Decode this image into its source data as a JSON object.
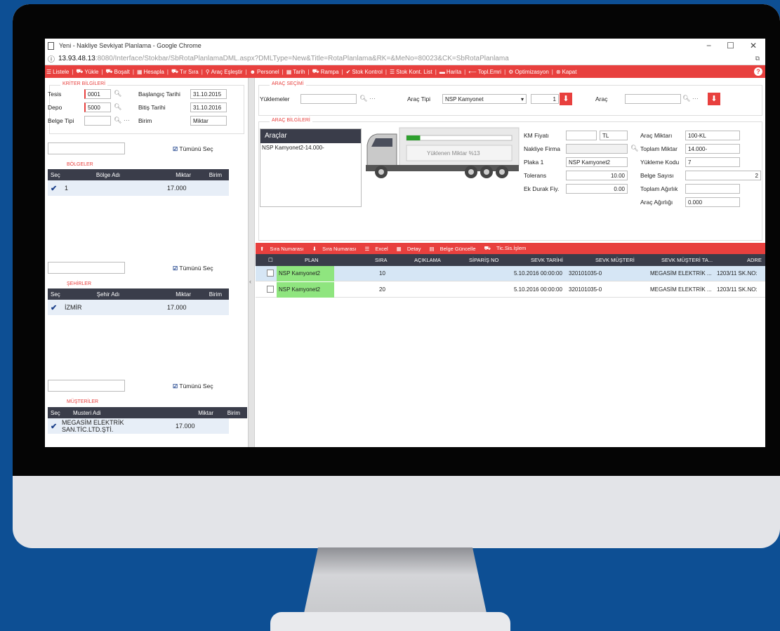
{
  "browser": {
    "title": "Yeni - Nakliye Sevkiyat Planlama - Google Chrome",
    "info_icon": "ⓘ",
    "url_host": "13.93.48.13",
    "url_path": ":8080/Interface/Stokbar/SbRotaPlanlamaDML.aspx?DMLType=New&Title=RotaPlanlama&RK=&MeNo=80023&CK=SbRotaPlanlama",
    "minimize": "−",
    "maximize": "☐",
    "close": "✕"
  },
  "menu": [
    {
      "icon": "list-icon",
      "label": "Listele"
    },
    {
      "icon": "truck-icon",
      "label": "Yükle"
    },
    {
      "icon": "truck-icon",
      "label": "Boşalt"
    },
    {
      "icon": "calculator-icon",
      "label": "Hesapla"
    },
    {
      "icon": "truck-order-icon",
      "label": "Tır Sıra"
    },
    {
      "icon": "match-icon",
      "label": "Araç Eşleştir"
    },
    {
      "icon": "person-icon",
      "label": "Personel"
    },
    {
      "icon": "calendar-icon",
      "label": "Tarih"
    },
    {
      "icon": "truck-icon",
      "label": "Rampa"
    },
    {
      "icon": "check-icon",
      "label": "Stok Kontrol"
    },
    {
      "icon": "list-icon",
      "label": "Stok Kont. List"
    },
    {
      "icon": "map-icon",
      "label": "Harita"
    },
    {
      "icon": "arrow-icon",
      "label": "Topl.Emri"
    },
    {
      "icon": "optimize-icon",
      "label": "Optimizasyon"
    },
    {
      "icon": "close-icon",
      "label": "Kapat"
    }
  ],
  "left": {
    "criteria_title": "KRİTER BİLGİLERİ",
    "tesis_label": "Tesis",
    "tesis_value": "0001",
    "depo_label": "Depo",
    "depo_value": "5000",
    "belge_tipi_label": "Belge Tipi",
    "start_label": "Başlangıç Tarihi",
    "start_value": "31.10.2015",
    "end_label": "Bitiş Tarihi",
    "end_value": "31.10.2016",
    "birim_label": "Birim",
    "birim_value": "Miktar",
    "select_all": "Tümünü Seç",
    "bolgeler": {
      "title": "BÖLGELER",
      "cols": [
        "Seç",
        "Bölge Adı",
        "Miktar",
        "Birim"
      ],
      "row": {
        "name": "1",
        "miktar": "17.000"
      }
    },
    "sehirler": {
      "title": "ŞEHİRLER",
      "cols": [
        "Seç",
        "Şehir Adı",
        "Miktar",
        "Birim"
      ],
      "row": {
        "name": "İZMİR",
        "miktar": "17.000"
      }
    },
    "musteriler": {
      "title": "MÜŞTERİLER",
      "cols": [
        "Seç",
        "Musteri Adi",
        "Miktar",
        "Birim"
      ],
      "row": {
        "name": "MEGASİM ELEKTRİK SAN.TİC.LTD.ŞTİ.",
        "miktar": "17.000"
      }
    }
  },
  "arac_secimi": {
    "title": "ARAÇ SEÇİMİ",
    "yuklemeler_label": "Yüklemeler",
    "arac_tipi_label": "Araç Tipi",
    "arac_tipi_value": "NSP Kamyonet",
    "qty": "1",
    "arac_label": "Araç"
  },
  "arac_bilgileri": {
    "title": "ARAÇ BİLGİLERİ",
    "araclar_title": "Araçlar",
    "araclar_item": "NSP Kamyonet2-14.000-",
    "load_text": "Yüklenen Miktar %13",
    "load_fraction": 0.13,
    "km_fiyati_label": "KM Fiyatı",
    "km_fiyati_unit": "TL",
    "nakliye_label": "Nakliye Firma",
    "plaka_label": "Plaka 1",
    "plaka_value": "NSP Kamyonet2",
    "tolerans_label": "Tolerans",
    "tolerans_value": "10.00",
    "ek_durak_label": "Ek Durak Fiy.",
    "ek_durak_value": "0.00",
    "arac_miktari_label": "Araç Miktarı",
    "arac_miktari_value": "100-KL",
    "toplam_miktar_label": "Toplam Miktar",
    "toplam_miktar_value": "14.000-",
    "yukleme_kodu_label": "Yükleme Kodu",
    "yukleme_kodu_value": "7",
    "belge_sayisi_label": "Belge Sayısı",
    "belge_sayisi_value": "2",
    "toplam_agirlik_label": "Toplam Ağırlık",
    "arac_agirligi_label": "Araç Ağırlığı",
    "arac_agirligi_value": "0.000"
  },
  "table_toolbar": [
    "Sıra Numarası",
    "Sıra Numarası",
    "Excel",
    "Detay",
    "Belge Güncelle",
    "Tic.Sis.İşlem"
  ],
  "table": {
    "cols": [
      "PLAN",
      "SIRA",
      "AÇIKLAMA",
      "SİPARİŞ NO",
      "SEVK TARİHİ",
      "SEVK MÜŞTERİ",
      "SEVK MÜŞTERİ TA...",
      "ADRE"
    ],
    "rows": [
      {
        "plan": "NSP Kamyonet2",
        "sira": "10",
        "tarih": "5.10.2016 00:00:00",
        "musteri": "320101035-0",
        "musteri_ta": "MEGASİM ELEKTRİK ...",
        "adres": "1203/11 SK.NO:"
      },
      {
        "plan": "NSP Kamyonet2",
        "sira": "20",
        "tarih": "5.10.2016 00:00:00",
        "musteri": "320101035-0",
        "musteri_ta": "MEGASİM ELEKTRİK ...",
        "adres": "1203/11 SK.NO:"
      }
    ]
  },
  "colors": {
    "accent": "#e8403e",
    "header": "#3a3d4a",
    "selected_row": "#d6e6f5",
    "plan_cell": "#8fe57f"
  }
}
